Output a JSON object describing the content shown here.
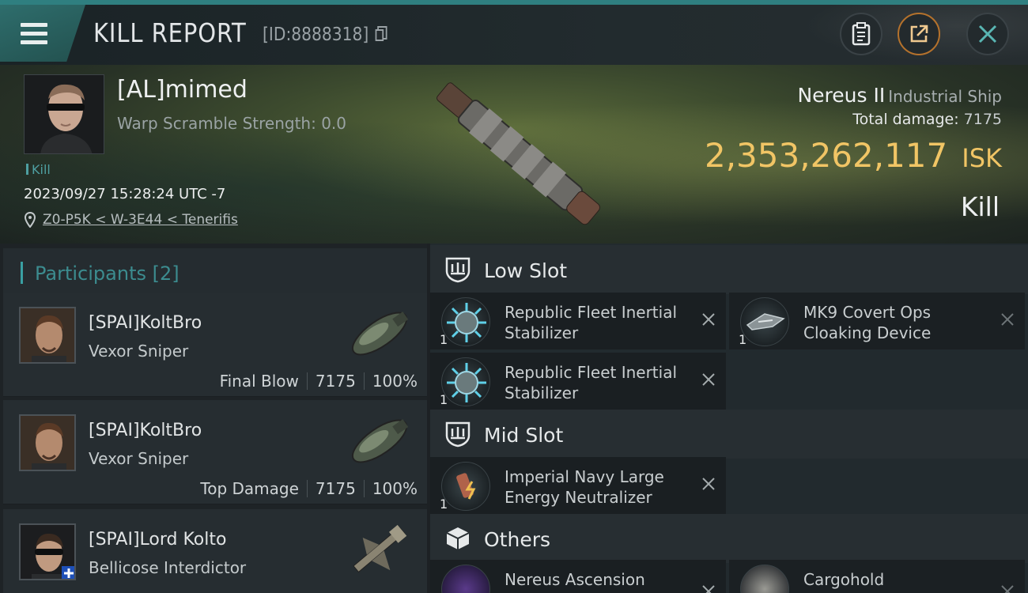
{
  "header": {
    "title": "KILL REPORT",
    "report_id": "[ID:8888318]"
  },
  "victim": {
    "name": "[AL]mimed",
    "subtitle": "Warp Scramble Strength: 0.0",
    "tag": "Kill",
    "datetime": "2023/09/27 15:28:24 UTC -7",
    "location": "Z0-P5K < W-3E44 < Tenerifis",
    "ship_name": "Nereus II",
    "ship_class": "Industrial Ship",
    "total_damage_label": "Total damage:",
    "total_damage": "7175",
    "isk_value": "2,353,262,117",
    "isk_unit": "ISK",
    "result": "Kill"
  },
  "participants": {
    "heading": "Participants [2]",
    "rows": [
      {
        "name": "[SPAI]KoltBro",
        "ship": "Vexor Sniper",
        "role": "Final Blow",
        "damage": "7175",
        "percent": "100%"
      },
      {
        "name": "[SPAI]KoltBro",
        "ship": "Vexor Sniper",
        "role": "Top Damage",
        "damage": "7175",
        "percent": "100%"
      },
      {
        "name": "[SPAI]Lord Kolto",
        "ship": "Bellicose Interdictor",
        "role": "",
        "damage": "",
        "percent": ""
      }
    ]
  },
  "slots": {
    "low": {
      "label": "Low Slot",
      "items": [
        {
          "name": "Republic Fleet Inertial Stabilizer",
          "qty": "1"
        },
        {
          "name": "MK9 Covert Ops Cloaking Device",
          "qty": "1"
        },
        {
          "name": "Republic Fleet Inertial Stabilizer",
          "qty": "1"
        }
      ]
    },
    "mid": {
      "label": "Mid Slot",
      "items": [
        {
          "name": "Imperial Navy Large Energy Neutralizer",
          "qty": "1"
        }
      ]
    },
    "others": {
      "label": "Others",
      "items": [
        {
          "name": "Nereus Ascension"
        },
        {
          "name": "Cargohold"
        }
      ]
    }
  },
  "colors": {
    "accent": "#3aa0a3",
    "isk": "#f1c565",
    "orange_button": "#b5722c"
  }
}
